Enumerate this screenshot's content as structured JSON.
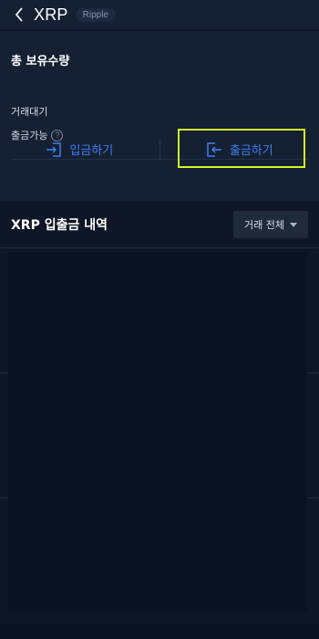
{
  "header": {
    "title": "XRP",
    "badge": "Ripple",
    "back_icon": "chevron-left-icon"
  },
  "holdings": {
    "total_label": "총 보유수량",
    "pending_label": "거래대기",
    "available_label": "출금가능",
    "help_icon_text": "?"
  },
  "actions": {
    "deposit_label": "입금하기",
    "withdraw_label": "출금하기",
    "deposit_icon": "login-arrow-icon",
    "withdraw_icon": "logout-arrow-icon",
    "accent": "#3d7ff0",
    "highlight_color": "#d4f52a"
  },
  "history": {
    "title": "XRP 입출금 내역",
    "filter_label": "거래 전체"
  }
}
